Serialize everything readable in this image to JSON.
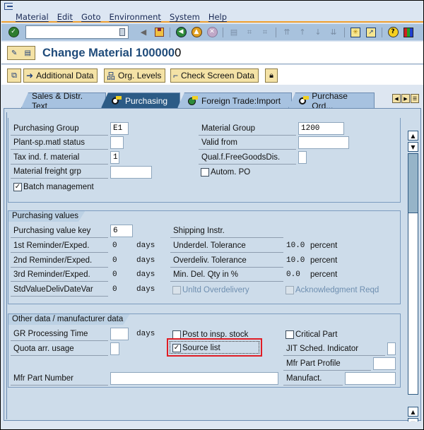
{
  "menu": [
    "Material",
    "Edit",
    "Goto",
    "Environment",
    "System",
    "Help"
  ],
  "toolbar": {
    "command_field_value": "",
    "icons": [
      "enter-icon",
      "command-dropdown-icon",
      "back-arrow-icon",
      "save-icon",
      "back-icon",
      "exit-icon",
      "cancel-icon",
      "print-icon",
      "find-icon",
      "find-next-icon",
      "first-page-icon",
      "previous-page-icon",
      "next-page-icon",
      "last-page-icon",
      "create-session-icon",
      "shortcut-icon",
      "help-icon",
      "layout-menu-icon"
    ]
  },
  "header": {
    "title_main": "Change Material 100000",
    "title_last": "0"
  },
  "app_toolbar": {
    "buttons": [
      "Additional Data",
      "Org. Levels",
      "Check Screen Data"
    ]
  },
  "tabs": [
    {
      "label": "Sales & Distr. Text",
      "active": false
    },
    {
      "label": "Purchasing",
      "active": true
    },
    {
      "label": "Foreign Trade:Import",
      "active": false
    },
    {
      "label": "Purchase Ord...",
      "active": false
    }
  ],
  "general": {
    "purchasing_group": {
      "label": "Purchasing Group",
      "value": "E1"
    },
    "plant_sp_matl_status": {
      "label": "Plant-sp.matl status",
      "value": ""
    },
    "tax_ind": {
      "label": "Tax ind. f. material",
      "value": "1"
    },
    "material_freight_grp": {
      "label": "Material freight grp",
      "value": ""
    },
    "batch_management": {
      "label": "Batch management",
      "checked": true
    },
    "material_group": {
      "label": "Material Group",
      "value": "1200"
    },
    "valid_from": {
      "label": "Valid from",
      "value": ""
    },
    "qual_free_goods": {
      "label": "Qual.f.FreeGoodsDis.",
      "value": ""
    },
    "autom_po": {
      "label": "Autom. PO",
      "checked": false
    }
  },
  "purchasing_values": {
    "title": "Purchasing values",
    "purchasing_value_key": {
      "label": "Purchasing value key",
      "value": "6"
    },
    "reminder1": {
      "label": "1st Reminder/Exped.",
      "value": "0",
      "unit": "days"
    },
    "reminder2": {
      "label": "2nd Reminder/Exped.",
      "value": "0",
      "unit": "days"
    },
    "reminder3": {
      "label": "3rd Reminder/Exped.",
      "value": "0",
      "unit": "days"
    },
    "std_value": {
      "label": "StdValueDelivDateVar",
      "value": "0",
      "unit": "days"
    },
    "shipping_instr": {
      "label": "Shipping Instr.",
      "value": ""
    },
    "underdel": {
      "label": "Underdel. Tolerance",
      "value": "10.0",
      "unit": "percent"
    },
    "overdel": {
      "label": "Overdeliv. Tolerance",
      "value": "10.0",
      "unit": "percent"
    },
    "min_del": {
      "label": "Min. Del. Qty in %",
      "value": "0.0",
      "unit": "percent"
    },
    "unltd_overdelivery": {
      "label": "Unltd Overdelivery",
      "checked": false,
      "disabled": true
    },
    "ack_reqd": {
      "label": "Acknowledgment Reqd",
      "checked": false,
      "disabled": true
    }
  },
  "other_data": {
    "title": "Other data / manufacturer data",
    "gr_processing_time": {
      "label": "GR Processing Time",
      "value": "",
      "unit": "days"
    },
    "quota_arr_usage": {
      "label": "Quota arr. usage",
      "value": ""
    },
    "post_to_insp": {
      "label": "Post to insp. stock",
      "checked": false
    },
    "source_list": {
      "label": "Source list",
      "checked": true
    },
    "critical_part": {
      "label": "Critical Part",
      "checked": false
    },
    "jit_sched": {
      "label": "JIT Sched. Indicator",
      "value": ""
    },
    "mfr_part_profile": {
      "label": "Mfr Part Profile",
      "value": ""
    },
    "mfr_part_number": {
      "label": "Mfr Part Number",
      "value": ""
    },
    "manufact": {
      "label": "Manufact.",
      "value": ""
    }
  },
  "colors": {
    "highlight": "#e01d25",
    "active_tab": "#2c5b86",
    "title": "#1f4b7a",
    "separator": "#f0a030"
  }
}
